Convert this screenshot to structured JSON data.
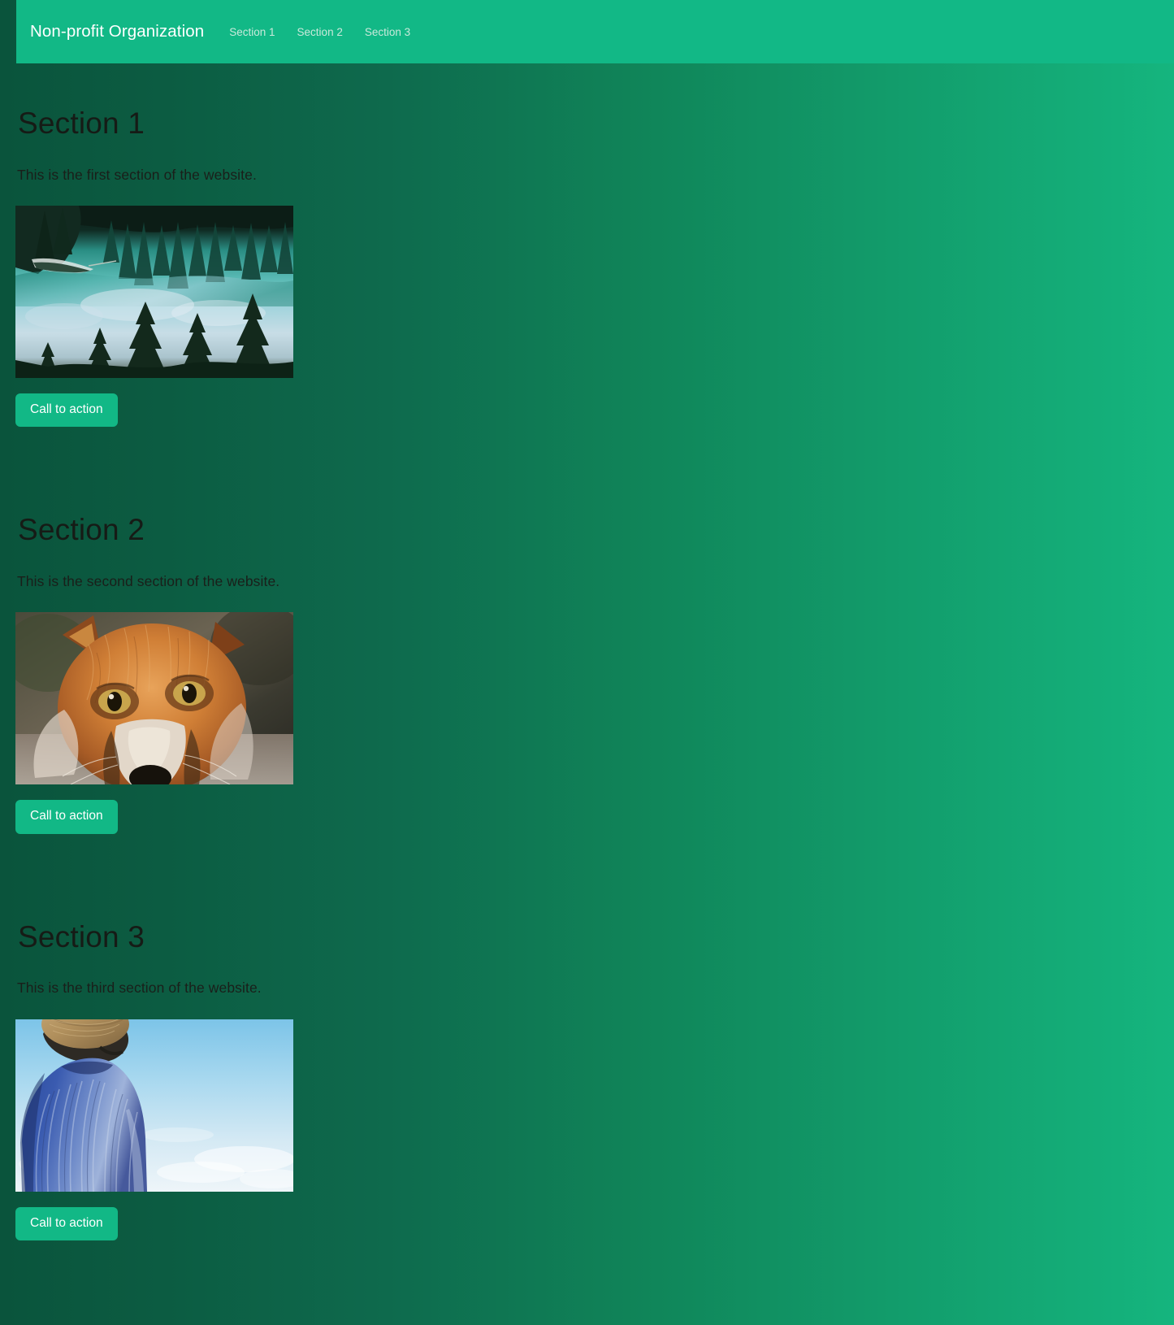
{
  "theme": {
    "navbar_bg": "#12b886",
    "accent": "#12b886",
    "page_gradient_from": "#0a543c",
    "page_gradient_to": "#15b57e",
    "nav_link_color": "#c9e9db",
    "brand_color": "#ffffff",
    "heading_color": "#161b16",
    "body_text_color": "#1a1f1a",
    "button_text_color": "#ffffff"
  },
  "navbar": {
    "brand": "Non-profit Organization",
    "links": [
      {
        "label": "Section 1"
      },
      {
        "label": "Section 2"
      },
      {
        "label": "Section 3"
      }
    ]
  },
  "sections": [
    {
      "heading": "Section 1",
      "text": "This is the first section of the website.",
      "image_name": "forest-lake-reflection-photo",
      "image_alt": "Upside-down photo of a turquoise mountain lake with pine trees reflected",
      "cta_label": "Call to action"
    },
    {
      "heading": "Section 2",
      "text": "This is the second section of the website.",
      "image_name": "red-fox-closeup-photo",
      "image_alt": "Close-up portrait of a red fox looking at the camera",
      "cta_label": "Call to action"
    },
    {
      "heading": "Section 3",
      "text": "This is the third section of the website.",
      "image_name": "person-straw-hat-sky-photo",
      "image_alt": "Person in a blue striped shirt and straw hat seen from behind against a blue sky",
      "cta_label": "Call to action"
    }
  ]
}
